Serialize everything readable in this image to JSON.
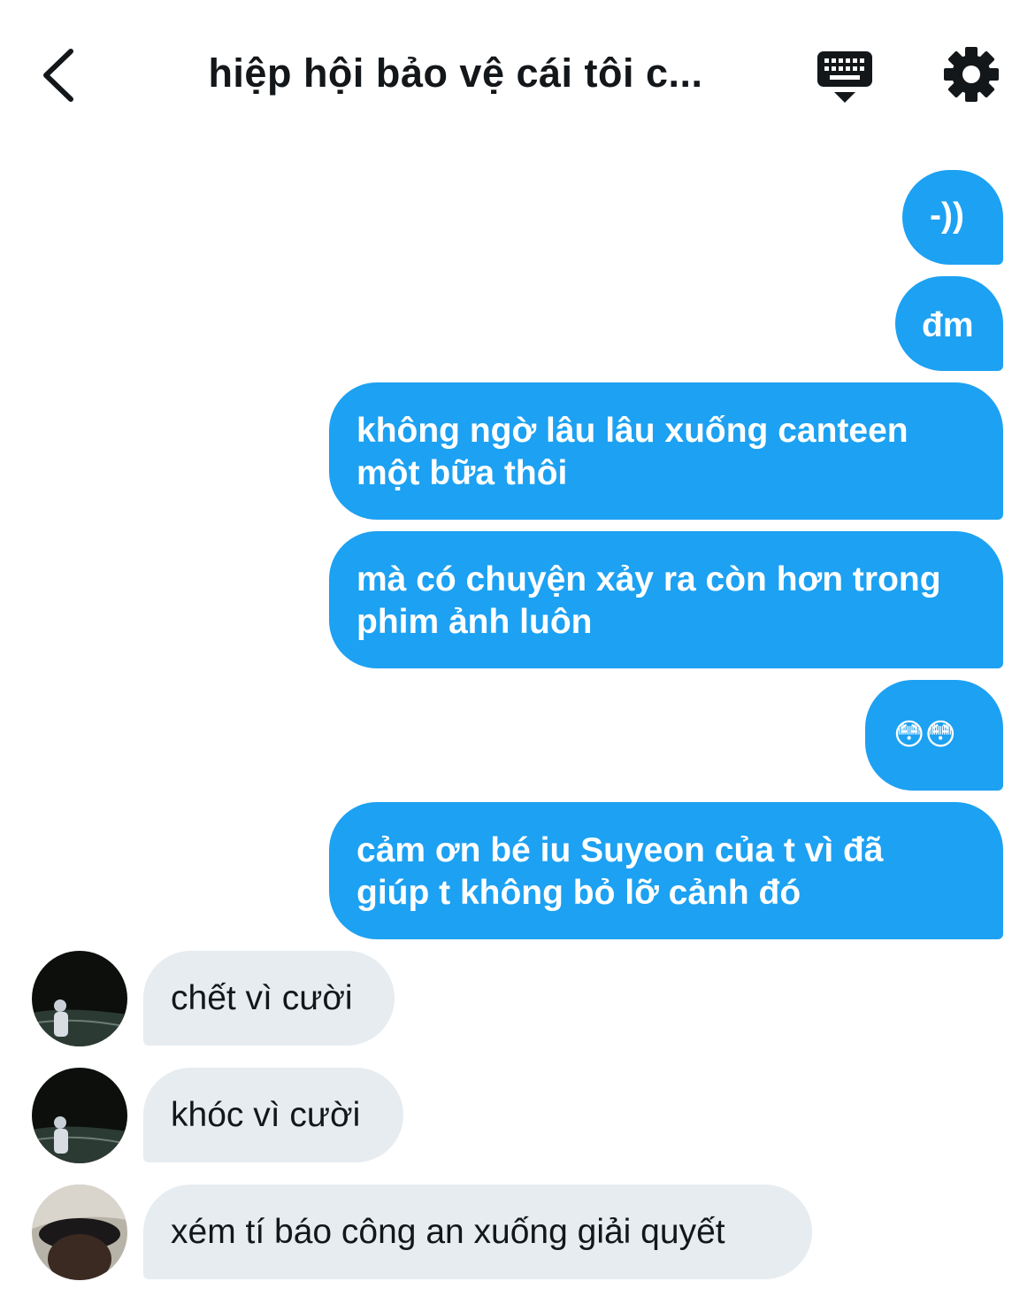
{
  "header": {
    "title": "hiệp hội bảo vệ cái tôi c...",
    "back_icon": "chevron-left-icon",
    "keyboard_icon": "keyboard-icon",
    "settings_icon": "gear-icon"
  },
  "colors": {
    "outgoing_bubble": "#1da1f2",
    "incoming_bubble": "#e6ecf0",
    "text_dark": "#14171a"
  },
  "messages": [
    {
      "direction": "outgoing",
      "lines": [
        "-))"
      ]
    },
    {
      "direction": "outgoing",
      "lines": [
        "đm"
      ]
    },
    {
      "direction": "outgoing",
      "lines": [
        "không ngờ lâu lâu xuống canteen",
        "một bữa thôi"
      ]
    },
    {
      "direction": "outgoing",
      "lines": [
        "mà có chuyện xảy ra còn hơn trong",
        "phim ảnh luôn"
      ]
    },
    {
      "direction": "outgoing",
      "lines": [
        "😳😳"
      ]
    },
    {
      "direction": "outgoing",
      "lines": [
        "cảm ơn bé iu Suyeon của t vì đã",
        "giúp t không bỏ lỡ cảnh đó"
      ]
    },
    {
      "direction": "incoming",
      "lines": [
        "chết vì cười"
      ]
    },
    {
      "direction": "incoming",
      "lines": [
        "khóc vì cười"
      ]
    },
    {
      "direction": "incoming",
      "lines": [
        "xém tí báo công an xuống giải quyết"
      ]
    }
  ]
}
